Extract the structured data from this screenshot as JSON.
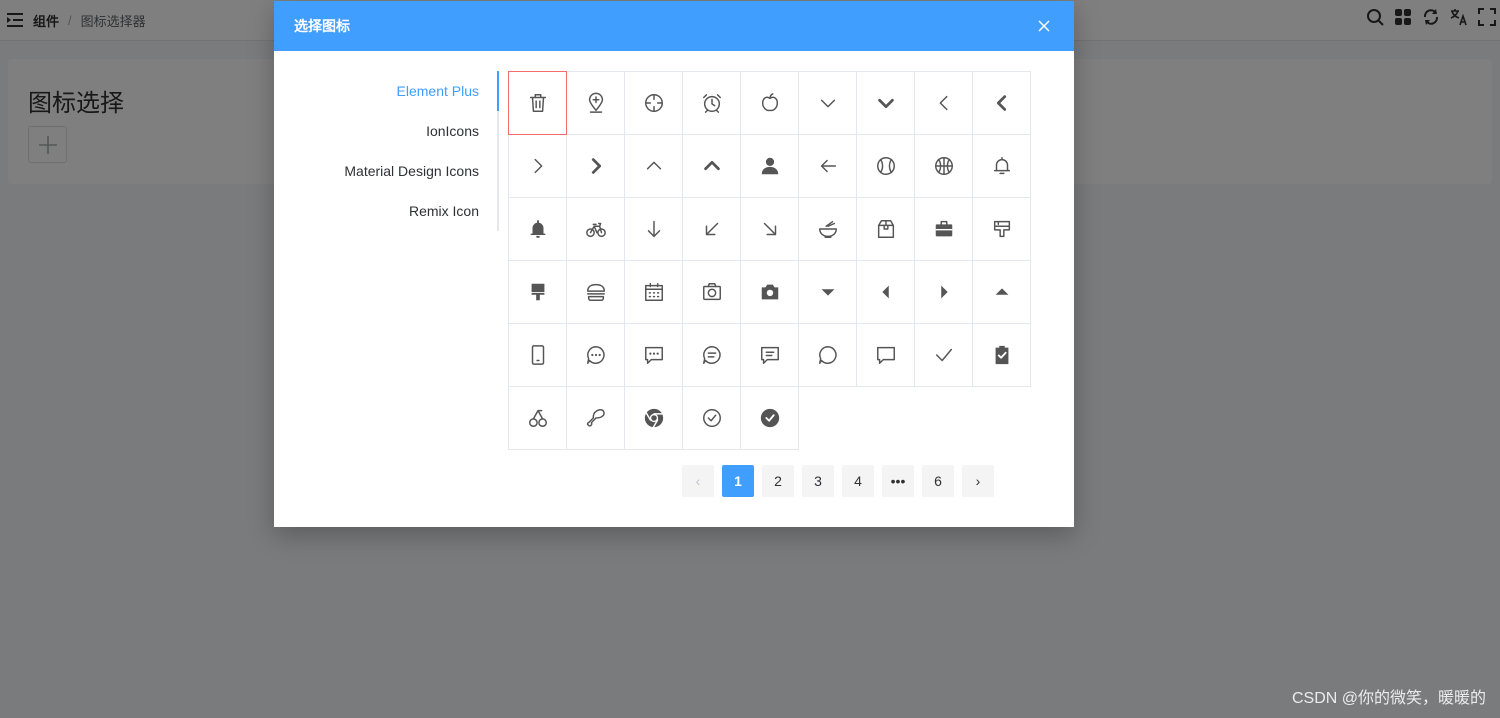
{
  "breadcrumb": {
    "parent": "组件",
    "current": "图标选择器"
  },
  "page": {
    "title": "图标选择"
  },
  "dialog": {
    "title": "选择图标"
  },
  "libraries": [
    "Element Plus",
    "IonIcons",
    "Material Design Icons",
    "Remix Icon"
  ],
  "active_library": "Element Plus",
  "icons": [
    "delete-icon",
    "add-location-icon",
    "aim-icon",
    "alarm-clock-icon",
    "apple-icon",
    "arrow-down-icon",
    "arrow-down-bold-icon",
    "arrow-left-icon",
    "arrow-left-bold-icon",
    "arrow-right-icon",
    "arrow-right-bold-icon",
    "arrow-up-icon",
    "arrow-up-bold-icon",
    "avatar-icon",
    "back-icon",
    "baseball-icon",
    "basketball-icon",
    "bell-icon",
    "bell-filled-icon",
    "bicycle-icon",
    "bottom-icon",
    "bottom-left-icon",
    "bottom-right-icon",
    "bowl-icon",
    "box-icon",
    "briefcase-icon",
    "brush-icon",
    "brush-filled-icon",
    "burger-icon",
    "calendar-icon",
    "camera-icon",
    "camera-filled-icon",
    "caret-bottom-icon",
    "caret-left-icon",
    "caret-right-icon",
    "caret-top-icon",
    "cellphone-icon",
    "chat-dot-round-icon",
    "chat-dot-square-icon",
    "chat-line-round-icon",
    "chat-line-square-icon",
    "chat-round-icon",
    "chat-square-icon",
    "check-icon",
    "checked-icon",
    "cherry-icon",
    "chicken-icon",
    "chrome-filled-icon",
    "circle-check-icon",
    "circle-check-filled-icon"
  ],
  "pagination": {
    "pages": [
      "1",
      "2",
      "3",
      "4",
      "•••",
      "6"
    ],
    "current": "1",
    "prev_symbol": "‹",
    "next_symbol": "›"
  },
  "watermark": "CSDN @你的微笑，暖暖的"
}
